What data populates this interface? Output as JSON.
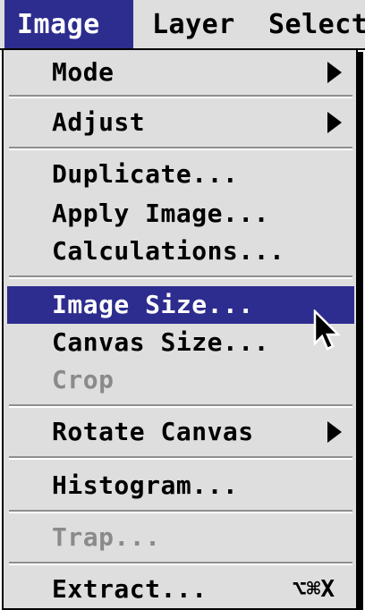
{
  "menubar": {
    "menus": [
      "Image",
      "Layer",
      "Select"
    ]
  },
  "image_menu": {
    "items": [
      {
        "label": "Mode",
        "submenu": true,
        "enabled": true
      },
      {
        "label": "Adjust",
        "submenu": true,
        "enabled": true
      },
      {
        "label": "Duplicate...",
        "enabled": true
      },
      {
        "label": "Apply Image...",
        "enabled": true
      },
      {
        "label": "Calculations...",
        "enabled": true
      },
      {
        "label": "Image Size...",
        "enabled": true,
        "highlighted": true
      },
      {
        "label": "Canvas Size...",
        "enabled": true
      },
      {
        "label": "Crop",
        "enabled": false
      },
      {
        "label": "Rotate Canvas",
        "submenu": true,
        "enabled": true
      },
      {
        "label": "Histogram...",
        "enabled": true
      },
      {
        "label": "Trap...",
        "enabled": false
      },
      {
        "label": "Extract...",
        "enabled": true,
        "shortcut": "⌥⌘X"
      }
    ]
  },
  "colors": {
    "highlight": "#2d2d8f",
    "menu_bg": "#dedede",
    "disabled_text": "#8a8a8a"
  },
  "cursor": {
    "icon": "arrow-cursor-icon"
  }
}
